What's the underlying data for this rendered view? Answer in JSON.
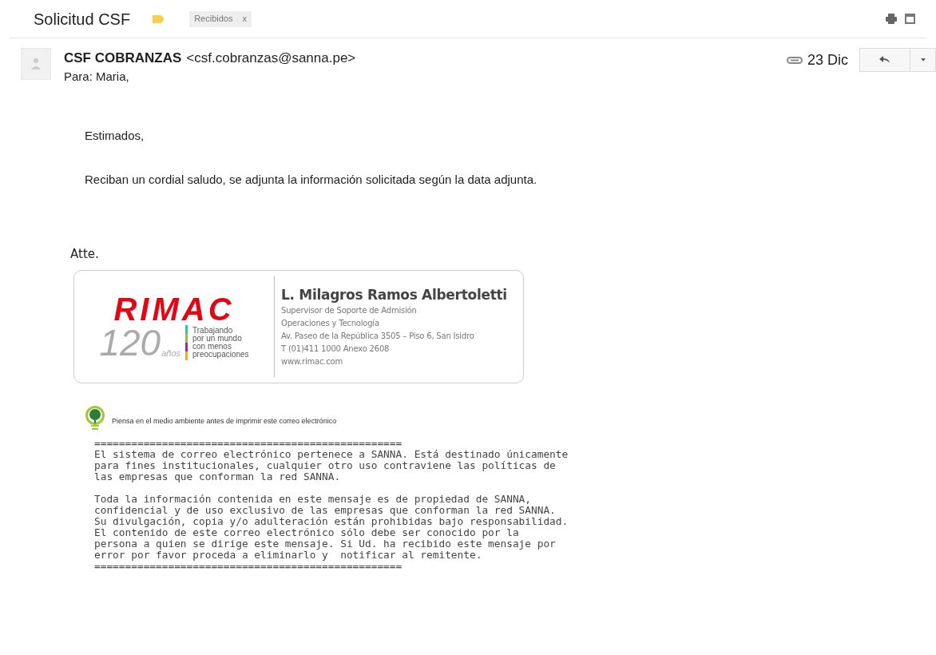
{
  "subject": "Solicitud CSF",
  "important": true,
  "labels": [
    {
      "text": "Recibidos",
      "remove": "x"
    }
  ],
  "sender": {
    "name": "CSF COBRANZAS",
    "email": "<csf.cobranzas@sanna.pe>",
    "to": "Para: Maria,",
    "date": "23 Dic",
    "has_attachment": true
  },
  "body": [
    "Estimados,",
    "Reciban un cordial saludo, se adjunta la información solicitada según la data adjunta."
  ],
  "closing": "Atte.",
  "signature": {
    "logo": "RIMAC",
    "years": "120",
    "years_unit": "años",
    "tagline": [
      "Trabajando",
      "por un mundo",
      "con menos",
      "preocupaciones"
    ],
    "name": "L. Milagros Ramos Albertoletti",
    "lines": [
      "Supervisor de Soporte de Admisión",
      "Operaciones y Tecnología",
      "Av. Paseo de la República 3505 – Piso 6, San Isidro",
      "T (01)411 1000 Anexo 2608",
      "www.rimac.com"
    ]
  },
  "eco_note": "Piensa en el medio ambiente antes de imprimir este correo electrónico",
  "disclaimer": [
    [
      "==================================================",
      "El sistema de correo electrónico pertenece a SANNA. Está destinado únicamente",
      "para fines institucionales, cualquier otro uso contraviene las políticas de",
      "las empresas que conforman la red SANNA."
    ],
    [
      "Toda la información contenida en este mensaje es de propiedad de SANNA,",
      "confidencial y de uso exclusivo de las empresas que conforman la red SANNA.",
      "Su divulgación, copia y/o adulteración están prohibidas bajo responsabilidad.",
      "El contenido de este correo electrónico sólo debe ser conocido por la",
      "persona a quien se dirige este mensaje. Si Ud. ha recibido este mensaje por",
      "error por favor proceda a eliminarlo y  notificar al remitente.",
      "=================================================="
    ]
  ]
}
